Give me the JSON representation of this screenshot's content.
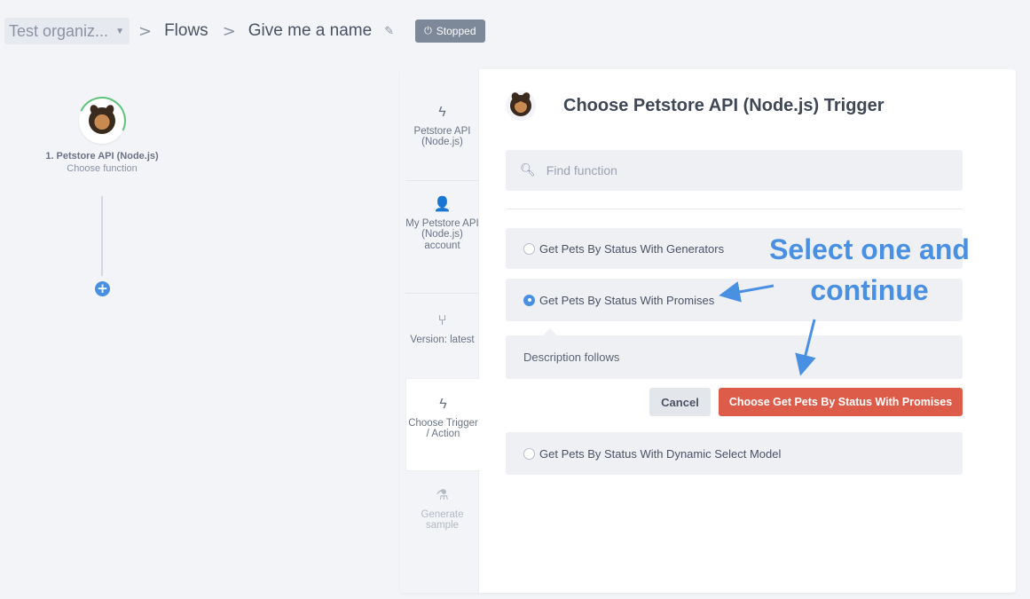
{
  "breadcrumb": {
    "org": "Test organiz...",
    "flows": "Flows",
    "flow_name": "Give me a name",
    "status": "Stopped"
  },
  "flow_canvas": {
    "node_title": "1. Petstore API (Node.js)",
    "node_subtitle": "Choose function"
  },
  "steps": [
    {
      "label": "Petstore API (Node.js)",
      "icon": "lightning-icon"
    },
    {
      "label": "My Petstore API (Node.js) account",
      "icon": "user-icon"
    },
    {
      "label": "Version: latest",
      "icon": "branch-icon"
    },
    {
      "label": "Choose Trigger / Action",
      "icon": "lightning-icon"
    },
    {
      "label": "Generate sample",
      "icon": "flask-icon"
    }
  ],
  "main": {
    "title": "Choose Petstore API (Node.js) Trigger",
    "search_placeholder": "Find function",
    "options": [
      {
        "label": "Get Pets By Status With Generators",
        "selected": false
      },
      {
        "label": "Get Pets By Status With Promises",
        "selected": true
      },
      {
        "label": "Get Pets By Status With Dynamic Select Model",
        "selected": false
      }
    ],
    "description": "Description follows",
    "cancel_label": "Cancel",
    "choose_label": "Choose Get Pets By Status With Promises"
  },
  "annotation": {
    "line1": "Select one and",
    "line2": "continue"
  },
  "colors": {
    "accent": "#4a90e2",
    "primary_button": "#dd5c49",
    "status_badge": "#7d8898"
  }
}
